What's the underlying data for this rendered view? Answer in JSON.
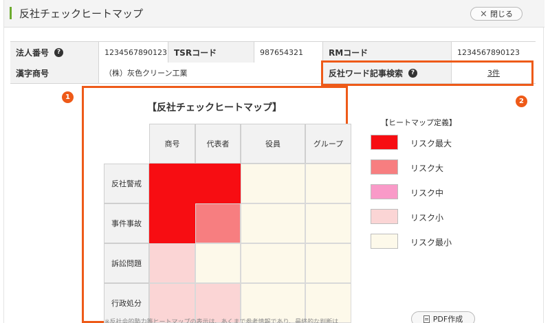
{
  "window": {
    "title": "反社チェックヒートマップ",
    "close_label": "閉じる",
    "close_symbol": "×"
  },
  "info": {
    "corp_no_label": "法人番号",
    "corp_no_value": "1234567890123",
    "tsr_label": "TSRコード",
    "tsr_value": "987654321",
    "rm_label": "RMコード",
    "rm_value": "1234567890123",
    "kanji_label": "漢字商号",
    "kanji_value": "（株）灰色クリーン工業",
    "article_label": "反社ワード記事検索",
    "article_value": "3件"
  },
  "badges": [
    "1",
    "2"
  ],
  "heatmap": {
    "title": "【反社チェックヒートマップ】",
    "columns": [
      "商号",
      "代表者",
      "役員",
      "グループ"
    ],
    "rows": [
      {
        "label": "反社警戒",
        "levels": [
          "max",
          "max",
          "min",
          "min"
        ]
      },
      {
        "label": "事件事故",
        "levels": [
          "max",
          "high",
          "min",
          "min"
        ]
      },
      {
        "label": "訴訟問題",
        "levels": [
          "low",
          "min",
          "min",
          "min"
        ]
      },
      {
        "label": "行政処分",
        "levels": [
          "low",
          "low",
          "min",
          "min"
        ]
      }
    ],
    "footnote": "※反社会的勢力等ヒートマップの表示は、あくまで参考情報であり、最終的な判断は"
  },
  "legend": {
    "title": "【ヒートマップ定義】",
    "items": [
      {
        "key": "max",
        "label": "リスク最大",
        "color": "#f70d12"
      },
      {
        "key": "high",
        "label": "リスク大",
        "color": "#f77e80"
      },
      {
        "key": "mid",
        "label": "リスク中",
        "color": "#f99ac8"
      },
      {
        "key": "low",
        "label": "リスク小",
        "color": "#fbd5d5"
      },
      {
        "key": "min",
        "label": "リスク最小",
        "color": "#fdf9ea"
      }
    ]
  },
  "pdf_button_label": "PDF作成",
  "accent_color": "#ee5a18"
}
